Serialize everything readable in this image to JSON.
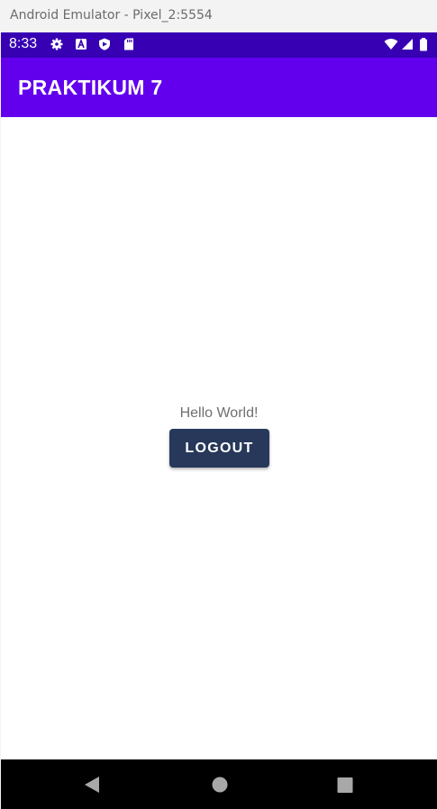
{
  "window": {
    "title": "Android Emulator - Pixel_2:5554"
  },
  "status_bar": {
    "time": "8:33",
    "left_icons": [
      "gear-icon",
      "a-icon",
      "shield-icon",
      "sd-card-icon"
    ],
    "right_icons": [
      "wifi-icon",
      "signal-icon",
      "battery-icon"
    ],
    "color": "#3700b3"
  },
  "app_bar": {
    "title": "PRAKTIKUM 7",
    "color": "#6200ee"
  },
  "main": {
    "greeting": "Hello World!",
    "logout_label": "LOGOUT",
    "button_color": "#27385a"
  },
  "nav_bar": {
    "buttons": [
      "back-icon",
      "home-icon",
      "recents-icon"
    ]
  }
}
